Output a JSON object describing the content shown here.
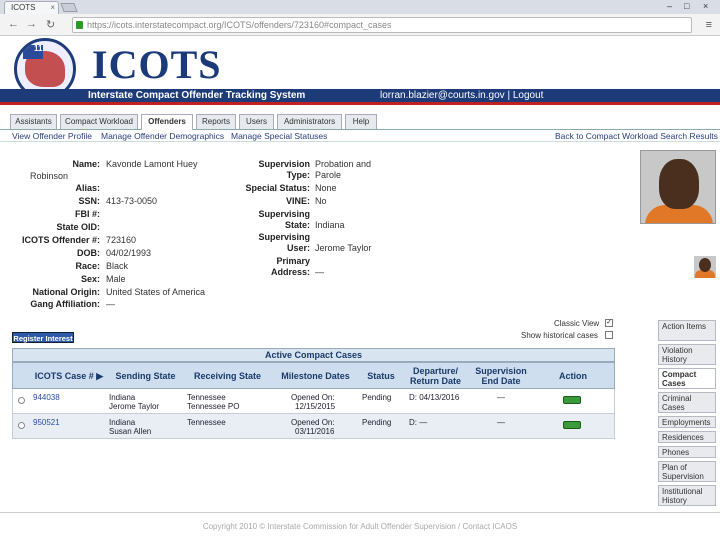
{
  "browser": {
    "tab_title": "ICOTS",
    "tab_close": "×",
    "url": "https://icots.interstatecompact.org/ICOTS/offenders/723160#compact_cases",
    "window_controls": [
      "–",
      "□",
      "×"
    ]
  },
  "header": {
    "seal_text": "11",
    "title": "ICOTS",
    "subtitle": "Interstate Compact Offender Tracking System",
    "user_email": "lorran.blazier@courts.in.gov",
    "separator": "|",
    "logout": "Logout"
  },
  "nav": {
    "tabs": [
      {
        "label": "Assistants"
      },
      {
        "label": "Compact Workload"
      },
      {
        "label": "Offenders"
      },
      {
        "label": "Reports"
      },
      {
        "label": "Users"
      },
      {
        "label": "Administrators"
      },
      {
        "label": "Help"
      }
    ],
    "active_tab": "Offenders"
  },
  "subnav": {
    "view_profile": "View Offender Profile",
    "manage_demographics": "Manage Offender Demographics",
    "manage_statuses": "Manage Special Statuses",
    "back_link": "Back to Compact Workload Search Results"
  },
  "offender": {
    "name_label": "Name:",
    "name_value": "Kavonde Lamont Huey",
    "name_value2": "Robinson",
    "alias_label": "Alias:",
    "alias_value": "",
    "ssn_label": "SSN:",
    "ssn_value": "413-73-0050",
    "fbi_label": "FBI #:",
    "fbi_value": "",
    "state_oid_label": "State OID:",
    "state_oid_value": "",
    "icots_label": "ICOTS Offender #:",
    "icots_value": "723160",
    "dob_label": "DOB:",
    "dob_value": "04/02/1993",
    "race_label": "Race:",
    "race_value": "Black",
    "sex_label": "Sex:",
    "sex_value": "Male",
    "origin_label": "National Origin:",
    "origin_value": "United States of America",
    "gang_label": "Gang Affiliation:",
    "gang_value": "—",
    "supervision_type_label": "Supervision Type:",
    "supervision_type_value": "Probation and Parole",
    "special_status_label": "Special Status:",
    "special_status_value": "None",
    "vine_label": "VINE:",
    "vine_value": "No",
    "supervising_state_label": "Supervising State:",
    "supervising_state_value": "Indiana",
    "supervising_user_label": "Supervising User:",
    "supervising_user_value": "Jerome Taylor",
    "primary_address_label": "Primary Address:",
    "primary_address_value": "—"
  },
  "cases": {
    "register_button": "Register Interest",
    "classic_view_label": "Classic View",
    "historical_label": "Show historical cases",
    "classic_checked": "✓",
    "title": "Active Compact Cases",
    "columns": {
      "case": "ICOTS Case # ▶",
      "sending": "Sending State",
      "receiving": "Receiving State",
      "milestone": "Milestone Dates",
      "status": "Status",
      "departure": "Departure/ Return Date",
      "supervision_end": "Supervision End Date",
      "action": "Action"
    },
    "rows": [
      {
        "case_no": "944038",
        "sending_state": "Indiana",
        "sending_user": "Jerome Taylor",
        "receiving_state": "Tennessee",
        "receiving_user": "Tennessee PO",
        "milestone_label": "Opened On:",
        "milestone_date": "12/15/2015",
        "status": "Pending",
        "departure": "D: 04/13/2016",
        "supervision_end": "—"
      },
      {
        "case_no": "950521",
        "sending_state": "Indiana",
        "sending_user": "Susan Allen",
        "receiving_state": "Tennessee",
        "receiving_user": "",
        "milestone_label": "Opened On:",
        "milestone_date": "03/11/2016",
        "status": "Pending",
        "departure": "D: —",
        "supervision_end": "—"
      }
    ]
  },
  "sidebar": {
    "items": [
      {
        "label": "Action Items"
      },
      {
        "label": "Violation History"
      },
      {
        "label": "Compact Cases"
      },
      {
        "label": "Criminal Cases"
      },
      {
        "label": "Employments"
      },
      {
        "label": "Residences"
      },
      {
        "label": "Phones"
      },
      {
        "label": "Plan of Supervision"
      },
      {
        "label": "Institutional History"
      }
    ]
  },
  "footer": {
    "text": "Copyright 2010 © Interstate Commission for Adult Offender Supervision / Contact ICAOS"
  }
}
